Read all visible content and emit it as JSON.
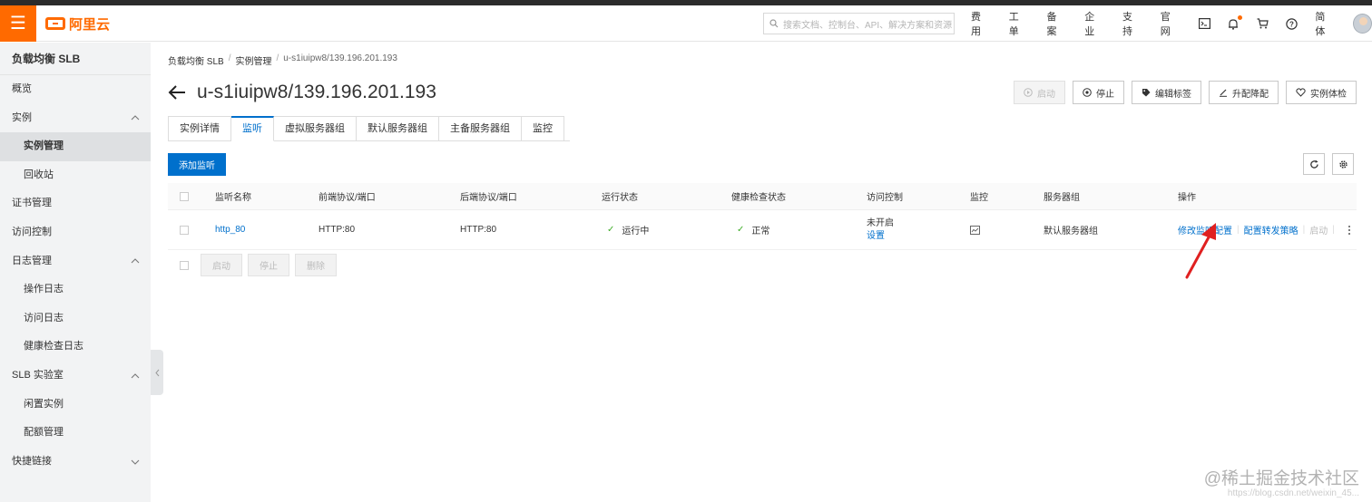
{
  "topbar": {
    "brand": "阿里云",
    "search_placeholder": "搜索文档、控制台、API、解决方案和资源",
    "nav": [
      "费用",
      "工单",
      "备案",
      "企业",
      "支持",
      "官网"
    ],
    "lang": "简体",
    "accent": "#ff6a00"
  },
  "sidebar": {
    "title": "负载均衡 SLB",
    "items": [
      {
        "label": "概览"
      },
      {
        "label": "实例"
      },
      {
        "label": "实例管理"
      },
      {
        "label": "回收站"
      },
      {
        "label": "证书管理"
      },
      {
        "label": "访问控制"
      },
      {
        "label": "日志管理"
      },
      {
        "label": "操作日志"
      },
      {
        "label": "访问日志"
      },
      {
        "label": "健康检查日志"
      },
      {
        "label": "SLB 实验室"
      },
      {
        "label": "闲置实例"
      },
      {
        "label": "配额管理"
      },
      {
        "label": "快捷链接"
      }
    ]
  },
  "breadcrumb": [
    "负载均衡 SLB",
    "实例管理",
    "u-s1iuipw8/139.196.201.193"
  ],
  "page_title": "u-s1iuipw8/139.196.201.193",
  "actions": [
    "启动",
    "停止",
    "编辑标签",
    "升配降配",
    "实例体检"
  ],
  "tabs": [
    "实例详情",
    "监听",
    "虚拟服务器组",
    "默认服务器组",
    "主备服务器组",
    "监控"
  ],
  "active_tab": "监听",
  "add_button": "添加监听",
  "table": {
    "headers": [
      "监听名称",
      "前端协议/端口",
      "后端协议/端口",
      "运行状态",
      "健康检查状态",
      "访问控制",
      "监控",
      "服务器组",
      "操作"
    ],
    "rows": [
      {
        "name": "http_80",
        "frontend": "HTTP:80",
        "backend": "HTTP:80",
        "run_status": "运行中",
        "health": "正常",
        "acl_status": "未开启",
        "acl_link": "设置",
        "server_group": "默认服务器组",
        "op1": "修改监听配置",
        "op2": "配置转发策略",
        "op3": "启动"
      }
    ]
  },
  "bulk_actions": [
    "启动",
    "停止",
    "删除"
  ],
  "watermark": "@稀土掘金技术社区",
  "watermark_sub": "https://blog.csdn.net/weixin_45..."
}
